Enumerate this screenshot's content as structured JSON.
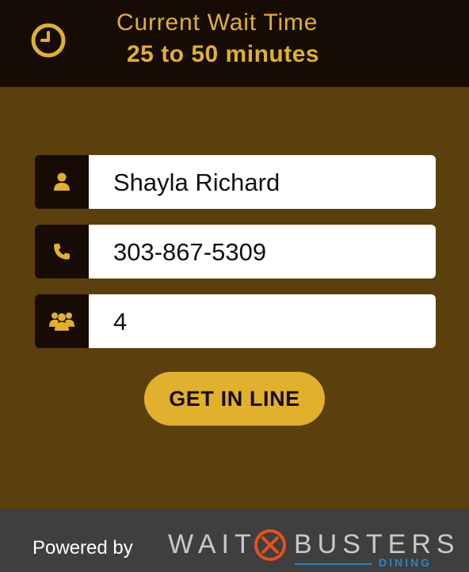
{
  "header": {
    "wait_title": "Current Wait Time",
    "wait_value": "25 to 50 minutes",
    "icon": "clock-icon"
  },
  "form": {
    "name_value": "Shayla Richard",
    "phone_value": "303-867-5309",
    "party_size_value": "4",
    "icons": [
      "user-icon",
      "phone-icon",
      "group-icon"
    ],
    "submit_label": "GET IN LINE"
  },
  "footer": {
    "powered_by": "Powered by",
    "logo_text_1": "WAIT",
    "logo_text_2": "BUSTERS",
    "logo_sub": "DINING"
  },
  "colors": {
    "header_bg": "#160b05",
    "main_bg": "#5b400e",
    "accent": "#e1b12d",
    "footer_bg": "#3f3f3f",
    "logo_orange": "#e8501e",
    "logo_blue": "#2b86c5"
  }
}
